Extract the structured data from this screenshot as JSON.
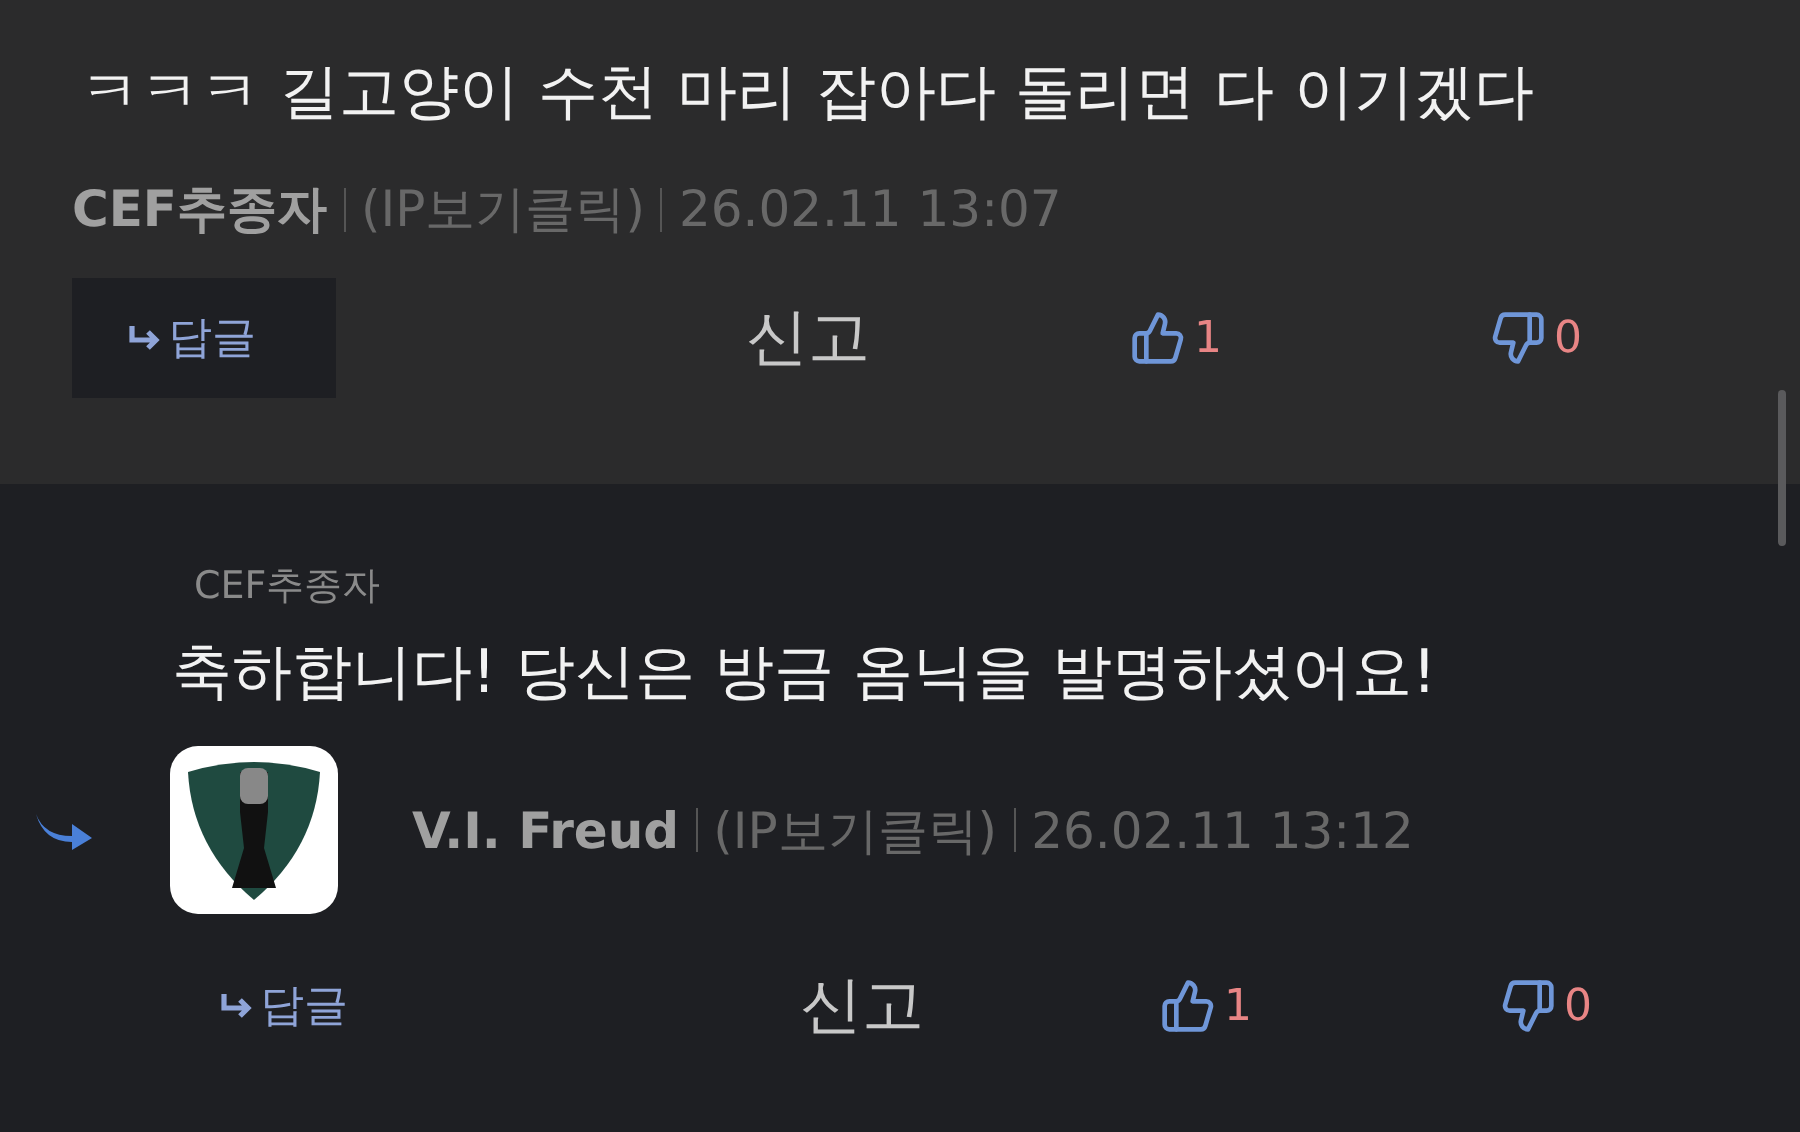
{
  "comments": [
    {
      "kind": "top",
      "text": "ㅋㅋㅋ 길고양이 수천 마리 잡아다 돌리면 다 이기겠다",
      "author": "CEF추종자",
      "ip": "(IP보기클릭)",
      "time": "26.02.11 13:07",
      "reply_label": "답글",
      "report_label": "신고",
      "likes": "1",
      "dislikes": "0"
    },
    {
      "kind": "reply",
      "reply_to": "CEF추종자",
      "text": "축하합니다! 당신은 방금 옴닉을 발명하셨어요!",
      "author": "V.I. Freud",
      "ip": "(IP보기클릭)",
      "time": "26.02.11 13:12",
      "reply_label": "답글",
      "report_label": "신고",
      "likes": "1",
      "dislikes": "0"
    }
  ]
}
